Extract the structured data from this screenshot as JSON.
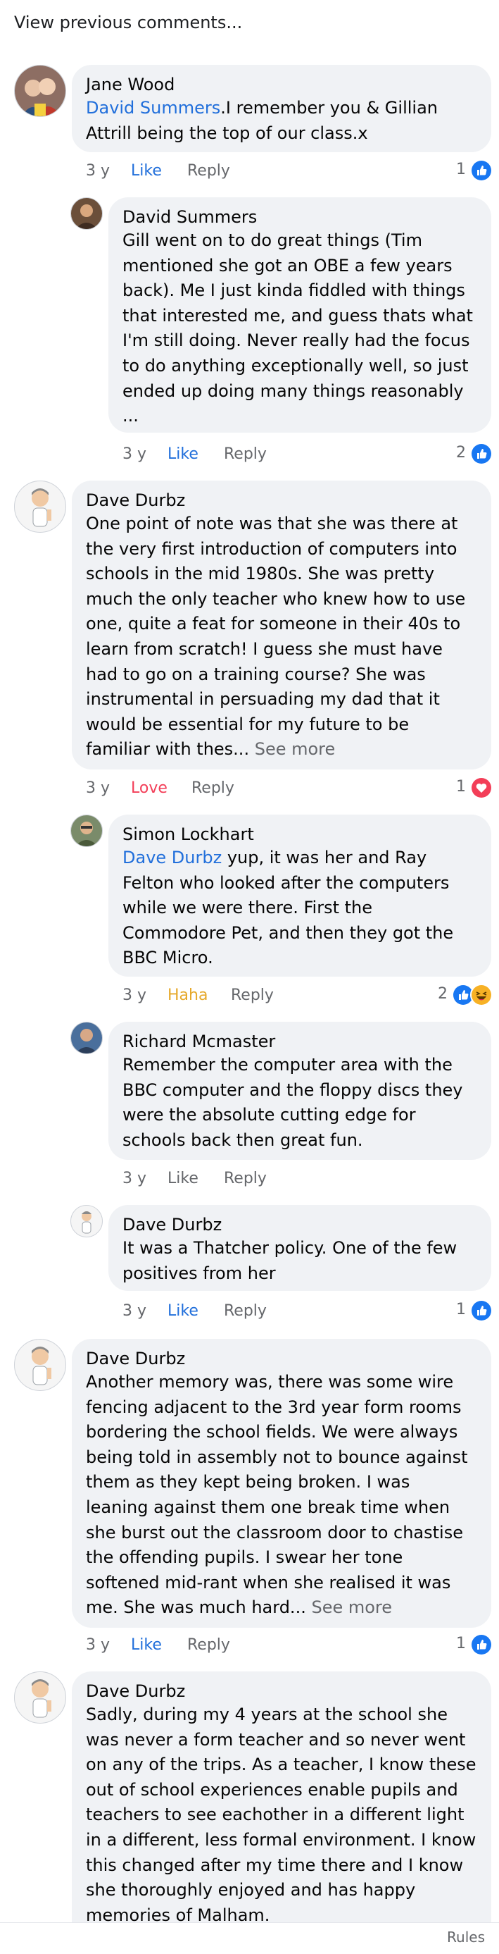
{
  "view_previous": "View previous comments...",
  "colors": {
    "link": "#216fdb",
    "bubble": "#f0f2f5",
    "love": "#f33e58",
    "haha": "#e6a92b",
    "muted": "#65676b"
  },
  "comments": [
    {
      "author": "Jane Wood",
      "mention": "David Summers",
      "text": ".I remember you & Gillian Attrill being the top of our class.x",
      "time": "3 y",
      "like": "Like",
      "reply": "Reply",
      "reactions": {
        "count": "1",
        "icons": [
          "like-icon"
        ]
      }
    },
    {
      "author": "David Summers",
      "text": "Gill went on to do great things (Tim mentioned she got an OBE a few years back). Me I just kinda fiddled with things that interested me, and guess thats what I'm still doing. Never really had the focus to do anything exceptionally well, so just ended up doing many things reasonably ...",
      "time": "3 y",
      "like": "Like",
      "reply": "Reply",
      "reactions": {
        "count": "2",
        "icons": [
          "like-icon"
        ]
      }
    },
    {
      "author": "Dave Durbz",
      "text": "One point of note was that she was there at the very first introduction of computers into schools in the mid 1980s. She was pretty much the only teacher who knew how to use one, quite a feat for someone in their 40s to learn from scratch! I guess she must have had to go on a training course? She was instrumental in persuading my dad that it would be essential for my future to be familiar with thes...",
      "see_more": "See more",
      "time": "3 y",
      "like": "Love",
      "reply": "Reply",
      "reactions": {
        "count": "1",
        "icons": [
          "love-icon"
        ]
      }
    },
    {
      "author": "Simon Lockhart",
      "mention": "Dave Durbz",
      "text": " yup, it was her and Ray Felton who looked after the computers while we were there. First the Commodore Pet, and then they got the BBC Micro.",
      "time": "3 y",
      "like": "Haha",
      "reply": "Reply",
      "reactions": {
        "count": "2",
        "icons": [
          "like-icon",
          "haha-icon"
        ]
      }
    },
    {
      "author": "Richard Mcmaster",
      "text": "Remember the computer area with the BBC  computer and the floppy discs they were the absolute cutting edge for schools back then great fun.",
      "time": "3 y",
      "like": "Like",
      "reply": "Reply"
    },
    {
      "author": "Dave Durbz",
      "text": "It was a Thatcher policy. One of the few positives from her",
      "time": "3 y",
      "like": "Like",
      "reply": "Reply",
      "reactions": {
        "count": "1",
        "icons": [
          "like-icon"
        ]
      }
    },
    {
      "author": "Dave Durbz",
      "text": "Another memory was, there was some wire fencing adjacent to the 3rd year form rooms bordering the school fields. We were always being told in assembly not to bounce against them as they kept being broken. I was leaning against them one break time when she burst out the classroom door to chastise the offending pupils. I swear her tone softened mid-rant when she realised it was me. She was much hard...",
      "see_more": "See more",
      "time": "3 y",
      "like": "Like",
      "reply": "Reply",
      "reactions": {
        "count": "1",
        "icons": [
          "like-icon"
        ]
      }
    },
    {
      "author": "Dave Durbz",
      "text": "Sadly, during my 4 years at the school she was never a form teacher and so never went on any of the trips. As a teacher, I know these out of school experiences enable pupils and teachers to see eachother in a different light in a different, less formal environment. I know this changed after my time there and I know she thoroughly enjoyed and has happy memories of Malham."
    }
  ],
  "footer": {
    "rules": "Rules"
  }
}
